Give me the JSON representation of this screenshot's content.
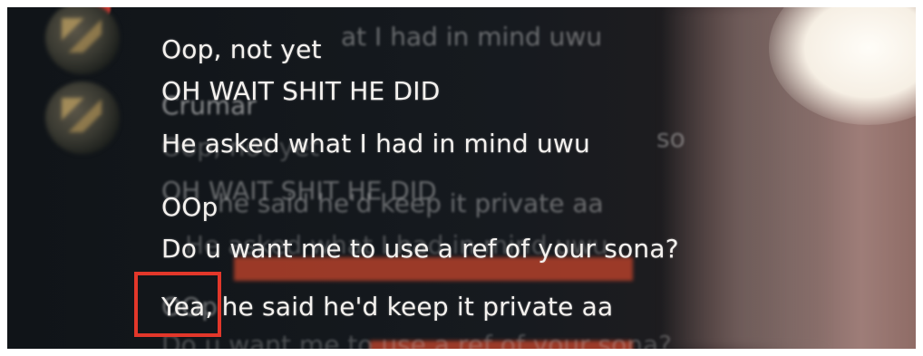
{
  "messages": [
    {
      "text": "Oop, not yet"
    },
    {
      "text": "OH WAIT SHIT HE DID"
    },
    {
      "text": "He asked what I had in mind uwu"
    },
    {
      "text": "OOp"
    },
    {
      "text": "Do u want me to use a ref of your sona?"
    },
    {
      "text": "Yea, he said he'd keep it private aa"
    }
  ],
  "ghost_text": {
    "overlay_a": "at I had in mind uwu",
    "username": "Crumar",
    "overlay_b": "so",
    "overlay_c": "Oop, not yet",
    "overlay_d": "OH WAIT SHIT HE DID",
    "overlay_e": "he said he'd keep it private aa",
    "overlay_f": "He asked what I had in mind uwu",
    "overlay_g": "OOp",
    "overlay_h": "Do u want me to use a ref of your sona?"
  },
  "colors": {
    "highlight": "#e2372a",
    "accent_bar": "#b3402a"
  }
}
